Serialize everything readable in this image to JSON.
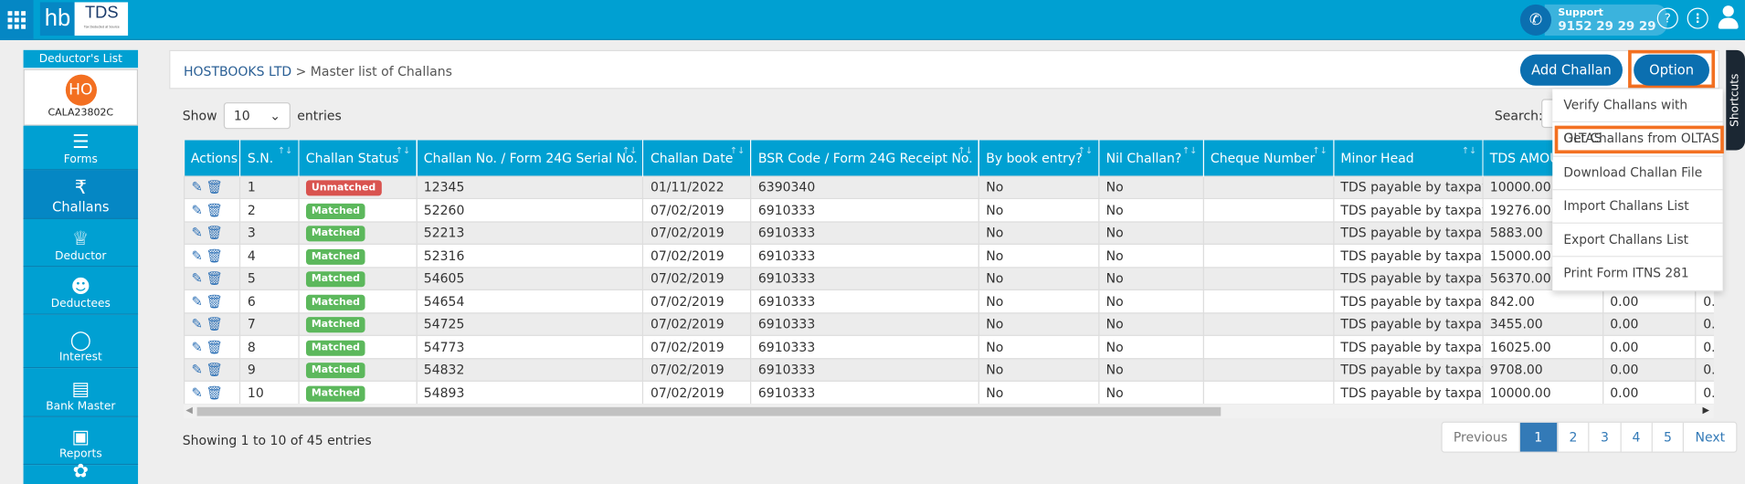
{
  "header": {
    "logo_hb": "hb",
    "logo_tds": "TDS",
    "logo_tagline": "Tax Deducted at Source",
    "support_label": "Support",
    "support_phone": "9152 29 29 29"
  },
  "sidebar": {
    "title": "Deductor's List",
    "deductor": {
      "initials": "HO",
      "pan": "CALA23802C"
    },
    "items": [
      {
        "label": "Forms",
        "icon": "forms-icon"
      },
      {
        "label": "Challans",
        "icon": "challan-icon",
        "active": true
      },
      {
        "label": "Deductor",
        "icon": "crown-icon"
      },
      {
        "label": "Deductees",
        "icon": "person-icon"
      },
      {
        "label": "Interest",
        "icon": "money-bag-icon"
      },
      {
        "label": "Bank Master",
        "icon": "bank-icon"
      },
      {
        "label": "Reports",
        "icon": "report-icon"
      },
      {
        "label": "",
        "icon": "lotus-icon"
      }
    ]
  },
  "breadcrumb": {
    "company": "HOSTBOOKS LTD",
    "separator": " > ",
    "page": "Master list of Challans"
  },
  "toolbar": {
    "add_label": "Add Challan",
    "option_label": "Option"
  },
  "options_menu": [
    "Verify Challans with OLTAS",
    "Get Challans from OLTAS",
    "Download Challan File",
    "Import Challans List",
    "Export Challans List",
    "Print Form ITNS 281"
  ],
  "options_highlighted": "Get Challans from OLTAS",
  "length": {
    "show": "Show",
    "value": "10",
    "entries": "entries"
  },
  "search": {
    "label": "Search:"
  },
  "table": {
    "columns": [
      "Actions",
      "S.N.",
      "Challan Status",
      "Challan No. / Form 24G Serial No.",
      "Challan Date",
      "BSR Code / Form 24G Receipt No.",
      "By book entry?",
      "Nil Challan?",
      "Cheque Number",
      "Minor Head",
      "TDS AMOUNT",
      "",
      ""
    ],
    "rows": [
      [
        "1",
        "Unmatched",
        "12345",
        "01/11/2022",
        "6390340",
        "No",
        "No",
        "",
        "TDS payable by taxpayer",
        "10000.00",
        "",
        ""
      ],
      [
        "2",
        "Matched",
        "52260",
        "07/02/2019",
        "6910333",
        "No",
        "No",
        "",
        "TDS payable by taxpayer",
        "19276.00",
        "",
        ""
      ],
      [
        "3",
        "Matched",
        "52213",
        "07/02/2019",
        "6910333",
        "No",
        "No",
        "",
        "TDS payable by taxpayer",
        "5883.00",
        "",
        ""
      ],
      [
        "4",
        "Matched",
        "52316",
        "07/02/2019",
        "6910333",
        "No",
        "No",
        "",
        "TDS payable by taxpayer",
        "15000.00",
        "",
        ""
      ],
      [
        "5",
        "Matched",
        "54605",
        "07/02/2019",
        "6910333",
        "No",
        "No",
        "",
        "TDS payable by taxpayer",
        "56370.00",
        "",
        ""
      ],
      [
        "6",
        "Matched",
        "54654",
        "07/02/2019",
        "6910333",
        "No",
        "No",
        "",
        "TDS payable by taxpayer",
        "842.00",
        "0.00",
        "0.00"
      ],
      [
        "7",
        "Matched",
        "54725",
        "07/02/2019",
        "6910333",
        "No",
        "No",
        "",
        "TDS payable by taxpayer",
        "3455.00",
        "0.00",
        "0.00"
      ],
      [
        "8",
        "Matched",
        "54773",
        "07/02/2019",
        "6910333",
        "No",
        "No",
        "",
        "TDS payable by taxpayer",
        "16025.00",
        "0.00",
        "0.00"
      ],
      [
        "9",
        "Matched",
        "54832",
        "07/02/2019",
        "6910333",
        "No",
        "No",
        "",
        "TDS payable by taxpayer",
        "9708.00",
        "0.00",
        "0.00"
      ],
      [
        "10",
        "Matched",
        "54893",
        "07/02/2019",
        "6910333",
        "No",
        "No",
        "",
        "TDS payable by taxpayer",
        "10000.00",
        "0.00",
        "0.00"
      ]
    ]
  },
  "status_colors": {
    "Matched": "#5cb85c",
    "Unmatched": "#d9534f"
  },
  "info": "Showing 1 to 10 of 45 entries",
  "pagination": {
    "previous": "Previous",
    "pages": [
      "1",
      "2",
      "3",
      "4",
      "5"
    ],
    "current": "1",
    "next": "Next"
  },
  "shortcuts_label": "Shortcuts",
  "colors": {
    "topbar": "#00a0d2",
    "accent": "#0b6fb0",
    "highlight": "#f37021"
  }
}
